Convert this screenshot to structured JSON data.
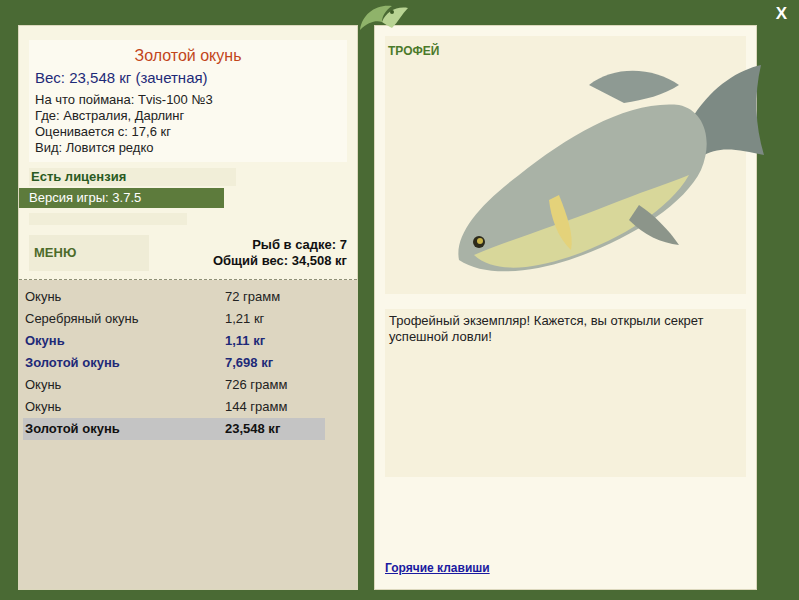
{
  "close": "X",
  "fish": {
    "title": "Золотой окунь",
    "weight": "Вес: 23,548 кг (зачетная)",
    "details": [
      "На что поймана: Tvis-100 №3",
      "Где: Австралия, Дарлинг",
      "Оценивается с: 17,6 кг",
      "Вид: Ловится редко"
    ]
  },
  "license": "Есть лицензия",
  "version": "Версия игры: 3.7.5",
  "menu_button": "МЕНЮ",
  "keepnet": {
    "count": "Рыб в садке: 7",
    "total": "Общий вес: 34,508 кг"
  },
  "catches": [
    {
      "name": "Окунь",
      "weight": "72 грамм",
      "trophy": false,
      "selected": false
    },
    {
      "name": "Серебряный окунь",
      "weight": "1,21 кг",
      "trophy": false,
      "selected": false
    },
    {
      "name": "Окунь",
      "weight": "1,11 кг",
      "trophy": true,
      "selected": false
    },
    {
      "name": "Золотой окунь",
      "weight": "7,698 кг",
      "trophy": true,
      "selected": false
    },
    {
      "name": "Окунь",
      "weight": "726 грамм",
      "trophy": false,
      "selected": false
    },
    {
      "name": "Окунь",
      "weight": "144 грамм",
      "trophy": false,
      "selected": false
    },
    {
      "name": "Золотой окунь",
      "weight": "23,548 кг",
      "trophy": false,
      "selected": true
    }
  ],
  "trophy": {
    "label": "ТРОФЕЙ",
    "message": "Трофейный экземпляр! Кажется, вы открыли секрет успешной ловли!"
  },
  "hotkeys_link": "Горячие клавиши"
}
